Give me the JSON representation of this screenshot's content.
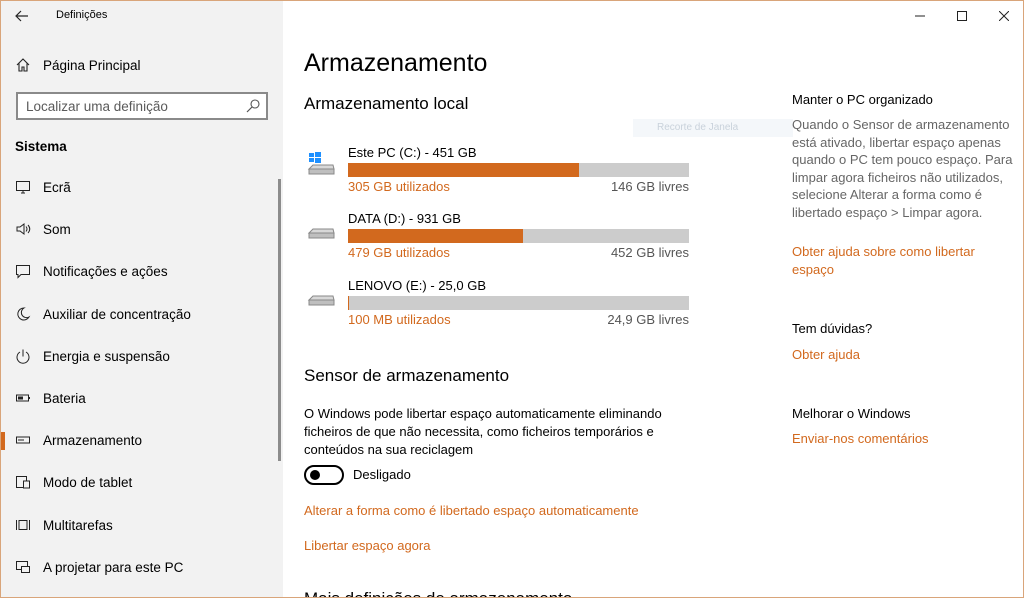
{
  "app": {
    "title": "Definições"
  },
  "sidebar": {
    "home_label": "Página Principal",
    "search_placeholder": "Localizar uma definição",
    "section": "Sistema",
    "items": [
      {
        "label": "Ecrã",
        "icon": "monitor-icon"
      },
      {
        "label": "Som",
        "icon": "speaker-icon"
      },
      {
        "label": "Notificações e ações",
        "icon": "notification-icon"
      },
      {
        "label": "Auxiliar de concentração",
        "icon": "moon-icon"
      },
      {
        "label": "Energia e suspensão",
        "icon": "power-icon"
      },
      {
        "label": "Bateria",
        "icon": "battery-icon"
      },
      {
        "label": "Armazenamento",
        "icon": "storage-icon",
        "active": true
      },
      {
        "label": "Modo de tablet",
        "icon": "tablet-icon"
      },
      {
        "label": "Multitarefas",
        "icon": "multitask-icon"
      },
      {
        "label": "A projetar para este PC",
        "icon": "project-icon"
      }
    ],
    "accent": "#d2691e"
  },
  "main": {
    "title": "Armazenamento",
    "local_title": "Armazenamento local",
    "drives": [
      {
        "name": "Este PC (C:) - 451 GB",
        "used": "305 GB utilizados",
        "free": "146 GB livres",
        "fraction": 0.676,
        "icon": "windows-drive-icon"
      },
      {
        "name": "DATA (D:) - 931 GB",
        "used": "479 GB utilizados",
        "free": "452 GB livres",
        "fraction": 0.514,
        "icon": "drive-icon"
      },
      {
        "name": "LENOVO (E:) - 25,0 GB",
        "used": "100 MB utilizados",
        "free": "24,9 GB livres",
        "fraction": 0.004,
        "icon": "drive-icon"
      }
    ],
    "ghost": "Recorte de Janela",
    "sense": {
      "title": "Sensor de armazenamento",
      "desc": "O Windows pode libertar espaço automaticamente eliminando ficheiros de que não necessita, como ficheiros temporários e conteúdos na sua reciclagem",
      "toggle_label": "Desligado",
      "link1": "Alterar a forma como é libertado espaço automaticamente",
      "link2": "Libertar espaço agora"
    },
    "more_title": "Mais definições de armazenamento"
  },
  "right": {
    "h1": "Manter o PC organizado",
    "p1": "Quando o Sensor de armazenamento está ativado, libertar espaço apenas quando o PC tem pouco espaço. Para limpar agora ficheiros não utilizados, selecione Alterar a forma como é libertado espaço > Limpar agora.",
    "l1": "Obter ajuda sobre como libertar espaço",
    "h2": "Tem dúvidas?",
    "l2": "Obter ajuda",
    "h3": "Melhorar o Windows",
    "l3": "Enviar-nos comentários"
  }
}
